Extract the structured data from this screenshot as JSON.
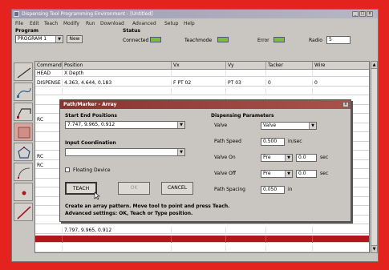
{
  "window": {
    "title": "Dispensing Tool Programming Environment - [Untitled]",
    "min": "_",
    "max": "□",
    "close": "x"
  },
  "menu": [
    "File",
    "Edit",
    "Teach",
    "Modify",
    "Run",
    "Download",
    "Advanced",
    "Setup",
    "Help"
  ],
  "program": {
    "label": "Program",
    "value": "PROGRAM 1",
    "new_button": "New"
  },
  "status": {
    "label": "Status",
    "connected": "Connected",
    "teachmode": "Teachmode",
    "error": "Error",
    "radio_label": "Radio",
    "radio_value": "5"
  },
  "grid": {
    "columns": [
      "Command",
      "Position",
      "Vx",
      "Vy",
      "Tacker",
      "Wire"
    ],
    "rows": [
      [
        "HEAD",
        "X Depth",
        "",
        "",
        "",
        ""
      ],
      [
        "DISPENSE",
        "4.363,  4.644,  0.183",
        "F PT 02",
        "PT 03",
        "0",
        "0"
      ],
      [
        "",
        "",
        "",
        "",
        "",
        ""
      ],
      [
        "",
        "",
        "",
        "",
        "",
        ""
      ],
      [
        "",
        "",
        "",
        "",
        "",
        ""
      ],
      [
        "RC",
        "",
        "",
        "",
        "",
        ""
      ],
      [
        "",
        "",
        "",
        "",
        "",
        ""
      ],
      [
        "",
        "",
        "",
        "",
        "",
        ""
      ],
      [
        "",
        "",
        "",
        "",
        "",
        ""
      ],
      [
        "RC",
        "",
        "",
        "",
        "",
        ""
      ],
      [
        "RC",
        "",
        "",
        "",
        "",
        ""
      ],
      [
        "",
        "",
        "",
        "",
        "",
        ""
      ],
      [
        "",
        "",
        "",
        "",
        "",
        ""
      ],
      [
        "",
        "",
        "",
        "",
        "",
        ""
      ],
      [
        "",
        "",
        "",
        "",
        "",
        ""
      ],
      [
        "",
        "",
        "",
        "",
        "",
        ""
      ],
      [
        "",
        "",
        "",
        "",
        "",
        ""
      ],
      [
        "",
        "7.797,  9.965,  0.912",
        "",
        "",
        "",
        ""
      ],
      [
        "",
        "",
        "",
        "",
        "",
        ""
      ],
      [
        "",
        "",
        "",
        "",
        "",
        ""
      ]
    ],
    "highlight_row": 18
  },
  "tools": [
    "line-tool",
    "arc-tool",
    "polyline-tool",
    "rect-tool",
    "circle-tool",
    "curve-tool",
    "dot-tool",
    "diagonal-line-tool"
  ],
  "dialog": {
    "title": "Path/Marker - Array",
    "close": "x",
    "start_group": "Start End Positions",
    "start_value": "7.747,  9.965,  0.912",
    "input_group": "Input Coordination",
    "input_value": "",
    "floating_device": "Floating Device",
    "teach": "TEACH",
    "ok": "OK",
    "cancel": "CANCEL",
    "hint_line1": "Create an array pattern. Move tool to point and press Teach.",
    "hint_line2": "Advanced settings: OK, Teach or Type position.",
    "params_group": "Dispensing Parameters",
    "valve_label": "Valve",
    "valve_value": "Valve",
    "path_speed_label": "Path Speed",
    "path_speed_value": "0.500",
    "path_speed_unit": "in/sec",
    "valve_on_label": "Valve On",
    "valve_on_mode": "Pre",
    "valve_on_value": "0.0",
    "valve_on_unit": "sec",
    "valve_off_label": "Valve Off",
    "valve_off_mode": "Pre",
    "valve_off_value": "0.0",
    "valve_off_unit": "sec",
    "path_spacing_label": "Path Spacing",
    "path_spacing_value": "0.050",
    "path_spacing_unit": "in"
  }
}
